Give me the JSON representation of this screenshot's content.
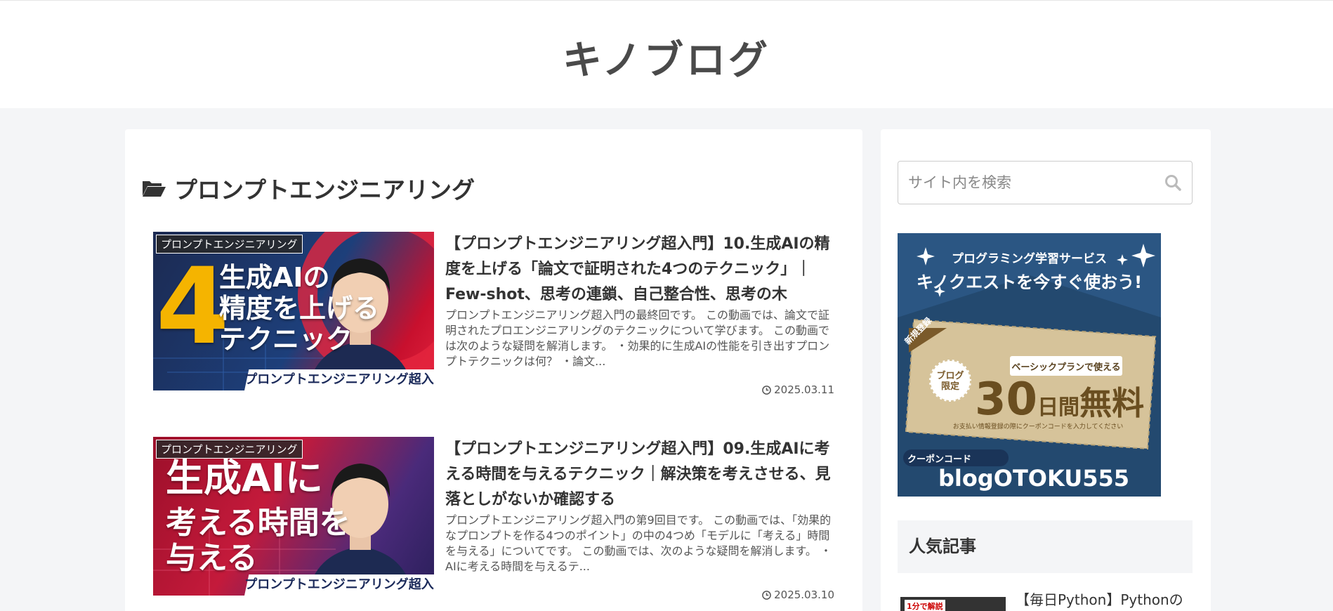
{
  "site": {
    "title": "キノブログ"
  },
  "archive": {
    "title": "プロンプトエンジニアリング"
  },
  "colors": {
    "accent": "#2b5683",
    "background": "#f4f5f7",
    "text": "#333333"
  },
  "entries": [
    {
      "category": "プロンプトエンジニアリング",
      "thumb_big_1": "4",
      "thumb_big_2": "生成AIの",
      "thumb_big_3": "精度を上げる",
      "thumb_big_4": "テクニック",
      "thumb_footer": "プロンプトエンジニアリング超入門",
      "title": "【プロンプトエンジニアリング超入門】10.生成AIの精度を上げる「論文で証明された4つのテクニック」｜Few-shot、思考の連鎖、自己整合性、思考の木",
      "snippet": "プロンプトエンジニアリング超入門の最終回です。 この動画では、論文で証明されたプロエンジニアリングのテクニックについて学びます。 この動画では次のような疑問を解消します。 ・効果的に生成AIの性能を引き出すプロンプトテクニックは何？ ・論文...",
      "date": "2025.03.11"
    },
    {
      "category": "プロンプトエンジニアリング",
      "thumb_big_1": "生成AIに",
      "thumb_big_2": "考える時間を",
      "thumb_big_3": "与える",
      "thumb_footer": "プロンプトエンジニアリング超入門",
      "title": "【プロンプトエンジニアリング超入門】09.生成AIに考える時間を与えるテクニック｜解決策を考えさせる、見落としがないか確認する",
      "snippet": "プロンプトエンジニアリング超入門の第9回目です。 この動画では、「効果的なプロンプトを作る4つのポイント」の中の4つめ「モデルに「考える」時間を与える」についてです。 この動画では、次のような疑問を解消します。 ・AIに考える時間を与えるテ...",
      "date": "2025.03.10"
    }
  ],
  "sidebar": {
    "search_placeholder": "サイト内を検索",
    "banner": {
      "line1": "プログラミング学習サービス",
      "line2": "キノクエストを今すぐ使おう!",
      "ribbon": "新規登録",
      "badge": "ブログ限定",
      "plan": "ベーシックプランで使える",
      "big_num": "30",
      "big_unit": "日間",
      "big_free": "無料",
      "small_note": "お支払い情報登録の際にクーポンコードを入力してください",
      "coupon_label": "クーポンコード",
      "coupon_code": "blogOTOKU555"
    },
    "popular_heading": "人気記事",
    "popular_items": [
      {
        "title": "【毎日Python】Pythonの",
        "thumb_label": "1分で解説"
      }
    ]
  }
}
